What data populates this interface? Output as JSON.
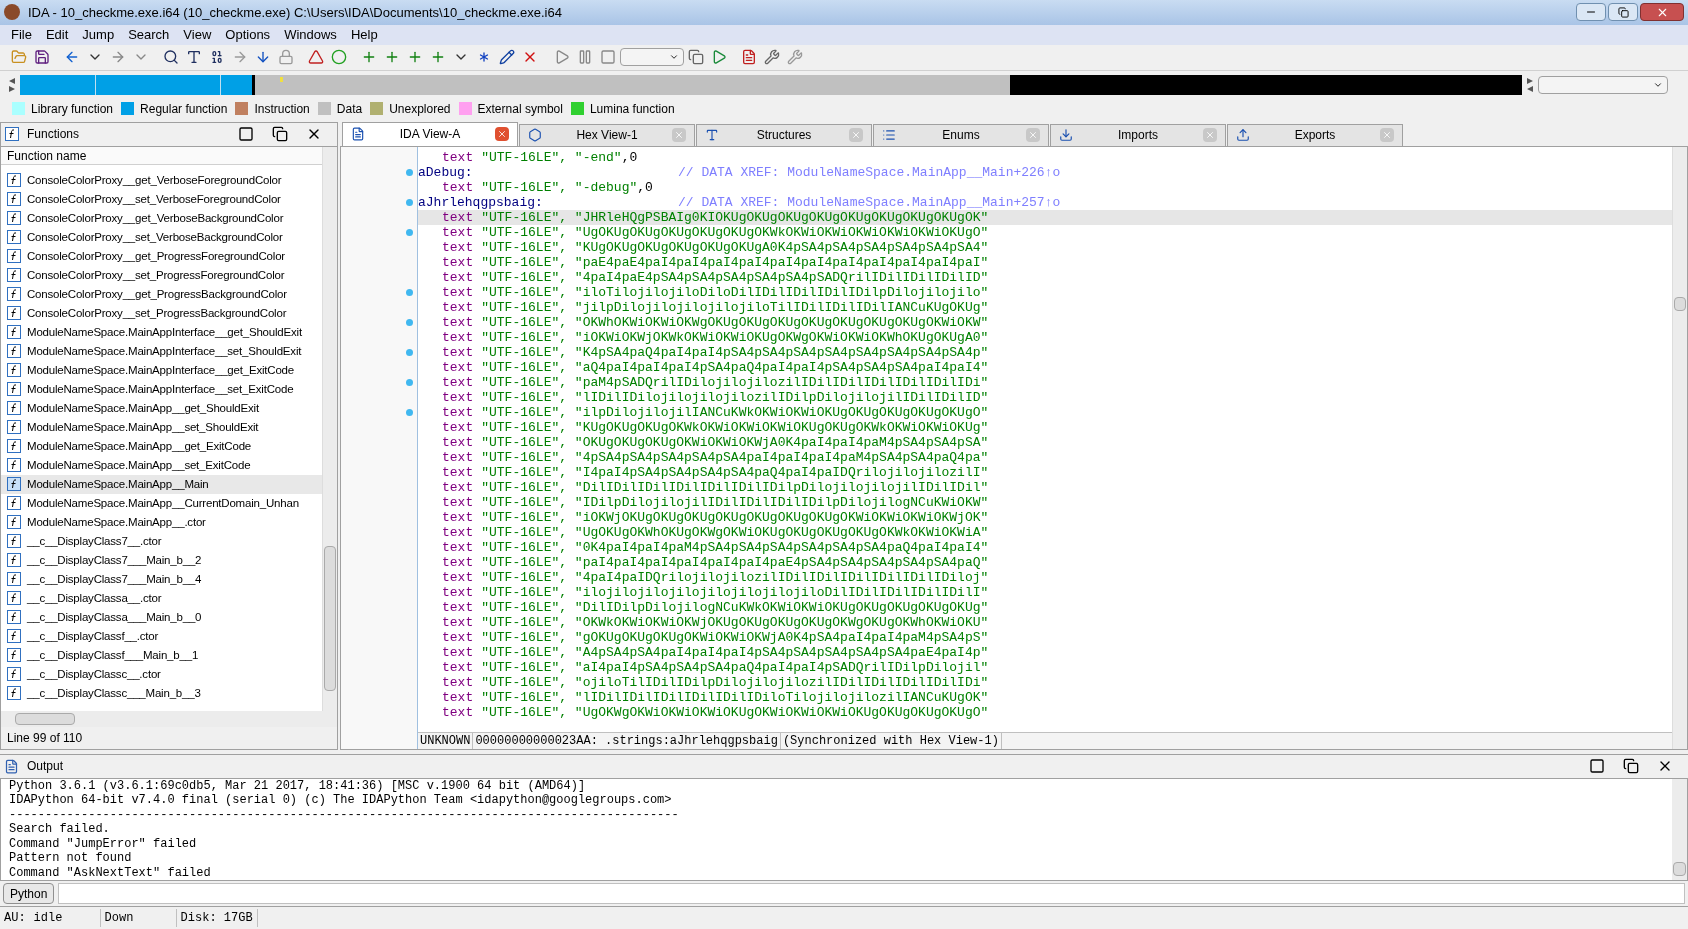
{
  "window": {
    "title": "IDA - 10_checkme.exe.i64 (10_checkme.exe) C:\\Users\\IDA\\Documents\\10_checkme.exe.i64"
  },
  "menu": [
    "File",
    "Edit",
    "Jump",
    "Search",
    "View",
    "Options",
    "Windows",
    "Help"
  ],
  "legend": [
    {
      "label": "Library function",
      "color": "#aaffff"
    },
    {
      "label": "Regular function",
      "color": "#00a0e6"
    },
    {
      "label": "Instruction",
      "color": "#c08060"
    },
    {
      "label": "Data",
      "color": "#c0c0c0"
    },
    {
      "label": "Unexplored",
      "color": "#b0b070"
    },
    {
      "label": "External symbol",
      "color": "#ffa0f0"
    },
    {
      "label": "Lumina function",
      "color": "#30d030"
    }
  ],
  "functions_panel": {
    "title": "Functions",
    "column": "Function name",
    "status": "Line 99 of 110",
    "items": [
      {
        "name": "ConsoleColorProxy__get_VerboseForegroundColor",
        "selected": false
      },
      {
        "name": "ConsoleColorProxy__set_VerboseForegroundColor",
        "selected": false
      },
      {
        "name": "ConsoleColorProxy__get_VerboseBackgroundColor",
        "selected": false
      },
      {
        "name": "ConsoleColorProxy__set_VerboseBackgroundColor",
        "selected": false
      },
      {
        "name": "ConsoleColorProxy__get_ProgressForegroundColor",
        "selected": false
      },
      {
        "name": "ConsoleColorProxy__set_ProgressForegroundColor",
        "selected": false
      },
      {
        "name": "ConsoleColorProxy__get_ProgressBackgroundColor",
        "selected": false
      },
      {
        "name": "ConsoleColorProxy__set_ProgressBackgroundColor",
        "selected": false
      },
      {
        "name": "ModuleNameSpace.MainAppInterface__get_ShouldExit",
        "selected": false
      },
      {
        "name": "ModuleNameSpace.MainAppInterface__set_ShouldExit",
        "selected": false
      },
      {
        "name": "ModuleNameSpace.MainAppInterface__get_ExitCode",
        "selected": false
      },
      {
        "name": "ModuleNameSpace.MainAppInterface__set_ExitCode",
        "selected": false
      },
      {
        "name": "ModuleNameSpace.MainApp__get_ShouldExit",
        "selected": false
      },
      {
        "name": "ModuleNameSpace.MainApp__set_ShouldExit",
        "selected": false
      },
      {
        "name": "ModuleNameSpace.MainApp__get_ExitCode",
        "selected": false
      },
      {
        "name": "ModuleNameSpace.MainApp__set_ExitCode",
        "selected": false
      },
      {
        "name": "ModuleNameSpace.MainApp__Main",
        "selected": true
      },
      {
        "name": "ModuleNameSpace.MainApp__CurrentDomain_Unhan",
        "selected": false
      },
      {
        "name": "ModuleNameSpace.MainApp__.ctor",
        "selected": false
      },
      {
        "name": "__c__DisplayClass7__.ctor",
        "selected": false
      },
      {
        "name": "__c__DisplayClass7___Main_b__2",
        "selected": false
      },
      {
        "name": "__c__DisplayClass7___Main_b__4",
        "selected": false
      },
      {
        "name": "__c__DisplayClassa__.ctor",
        "selected": false
      },
      {
        "name": "__c__DisplayClassa___Main_b__0",
        "selected": false
      },
      {
        "name": "__c__DisplayClassf__.ctor",
        "selected": false
      },
      {
        "name": "__c__DisplayClassf___Main_b__1",
        "selected": false
      },
      {
        "name": "__c__DisplayClassc__.ctor",
        "selected": false
      },
      {
        "name": "__c__DisplayClassc___Main_b__3",
        "selected": false
      }
    ]
  },
  "tabs": [
    {
      "label": "IDA View-A",
      "selected": true
    },
    {
      "label": "Hex View-1",
      "selected": false
    },
    {
      "label": "Structures",
      "selected": false
    },
    {
      "label": "Enums",
      "selected": false
    },
    {
      "label": "Imports",
      "selected": false
    },
    {
      "label": "Exports",
      "selected": false
    }
  ],
  "listing": [
    {
      "kind": "data",
      "keyword": "text",
      "operand": "\"UTF-16LE\", \"-end\"",
      "tail": ",0",
      "dot": false,
      "current": false
    },
    {
      "kind": "label",
      "name": "aDebug:",
      "comment": "// DATA XREF: ModuleNameSpace.MainApp__Main+226↑o",
      "dot": true,
      "current": false
    },
    {
      "kind": "data",
      "keyword": "text",
      "operand": "\"UTF-16LE\", \"-debug\"",
      "tail": ",0",
      "dot": false,
      "current": false
    },
    {
      "kind": "label",
      "name": "aJhrlehqgpsbaig:",
      "comment": "// DATA XREF: ModuleNameSpace.MainApp__Main+257↑o",
      "dot": true,
      "current": false
    },
    {
      "kind": "data",
      "keyword": "text",
      "operand": "\"UTF-16LE\", \"JHRleHQgPSBAIg0KIOKUgOKUgOKUgOKUgOKUgOKUgOKUgOKUgOK\"",
      "dot": false,
      "current": true
    },
    {
      "kind": "data",
      "keyword": "text",
      "operand": "\"UTF-16LE\", \"UgOKUgOKUgOKUgOKUgOKUgOKWkOKWiOKWiOKWiOKWiOKWiOKUgO\"",
      "dot": true,
      "current": false
    },
    {
      "kind": "data",
      "keyword": "text",
      "operand": "\"UTF-16LE\", \"KUgOKUgOKUgOKUgOKUgOKUgA0K4pSA4pSA4pSA4pSA4pSA4pSA4\"",
      "dot": false,
      "current": false
    },
    {
      "kind": "data",
      "keyword": "text",
      "operand": "\"UTF-16LE\", \"paE4paE4paI4paI4paI4paI4paI4paI4paI4paI4paI4paI4paI\"",
      "dot": false,
      "current": false
    },
    {
      "kind": "data",
      "keyword": "text",
      "operand": "\"UTF-16LE\", \"4paI4paE4pSA4pSA4pSA4pSA4pSA4pSADQrilIDilIDilIDilID\"",
      "dot": false,
      "current": false
    },
    {
      "kind": "data",
      "keyword": "text",
      "operand": "\"UTF-16LE\", \"iloTilojilojiloDiloDilIDilIDilIDilIDilpDilojilojilo\"",
      "dot": true,
      "current": false
    },
    {
      "kind": "data",
      "keyword": "text",
      "operand": "\"UTF-16LE\", \"jilpDilojilojilojilojiloTilIDilIDilIDilIANCuKUgOKUg\"",
      "dot": false,
      "current": false
    },
    {
      "kind": "data",
      "keyword": "text",
      "operand": "\"UTF-16LE\", \"OKWhOKWiOKWiOKWgOKUgOKUgOKUgOKUgOKUgOKUgOKUgOKWiOKW\"",
      "dot": true,
      "current": false
    },
    {
      "kind": "data",
      "keyword": "text",
      "operand": "\"UTF-16LE\", \"iOKWiOKWjOKWkOKWiOKWiOKUgOKWgOKWiOKWiOKWhOKUgOKUgA0\"",
      "dot": false,
      "current": false
    },
    {
      "kind": "data",
      "keyword": "text",
      "operand": "\"UTF-16LE\", \"K4pSA4paQ4paI4paI4pSA4pSA4pSA4pSA4pSA4pSA4pSA4pSA4p\"",
      "dot": true,
      "current": false
    },
    {
      "kind": "data",
      "keyword": "text",
      "operand": "\"UTF-16LE\", \"aQ4paI4paI4paI4pSA4paQ4paI4paI4pSA4pSA4pSA4paI4paI4\"",
      "dot": false,
      "current": false
    },
    {
      "kind": "data",
      "keyword": "text",
      "operand": "\"UTF-16LE\", \"paM4pSADQrilIDilojilojilozilIDilIDilIDilIDilIDilIDi\"",
      "dot": true,
      "current": false
    },
    {
      "kind": "data",
      "keyword": "text",
      "operand": "\"UTF-16LE\", \"lIDilIDilojilojilojilozilIDilpDilojilojilIDilIDilID\"",
      "dot": false,
      "current": false
    },
    {
      "kind": "data",
      "keyword": "text",
      "operand": "\"UTF-16LE\", \"ilpDilojilojilIANCuKWkOKWiOKWiOKUgOKUgOKUgOKUgOKUgO\"",
      "dot": true,
      "current": false
    },
    {
      "kind": "data",
      "keyword": "text",
      "operand": "\"UTF-16LE\", \"KUgOKUgOKUgOKWkOKWiOKWiOKWiOKUgOKUgOKWkOKWiOKWiOKUg\"",
      "dot": false,
      "current": false
    },
    {
      "kind": "data",
      "keyword": "text",
      "operand": "\"UTF-16LE\", \"OKUgOKUgOKUgOKWiOKWiOKWjA0K4paI4paI4paM4pSA4pSA4pSA\"",
      "dot": false,
      "current": false
    },
    {
      "kind": "data",
      "keyword": "text",
      "operand": "\"UTF-16LE\", \"4pSA4pSA4pSA4pSA4pSA4paI4paI4paI4paM4pSA4pSA4paQ4pa\"",
      "dot": false,
      "current": false
    },
    {
      "kind": "data",
      "keyword": "text",
      "operand": "\"UTF-16LE\", \"I4paI4pSA4pSA4pSA4pSA4paQ4paI4paIDQrilojilojilozilI\"",
      "dot": false,
      "current": false
    },
    {
      "kind": "data",
      "keyword": "text",
      "operand": "\"UTF-16LE\", \"DilIDilIDilIDilIDilIDilIDilpDilojilojilojilIDilIDil\"",
      "dot": false,
      "current": false
    },
    {
      "kind": "data",
      "keyword": "text",
      "operand": "\"UTF-16LE\", \"IDilpDilojilojilIDilIDilIDilIDilpDilojilogNCuKWiOKW\"",
      "dot": false,
      "current": false
    },
    {
      "kind": "data",
      "keyword": "text",
      "operand": "\"UTF-16LE\", \"iOKWjOKUgOKUgOKUgOKUgOKUgOKUgOKUgOKWiOKWiOKWiOKWjOK\"",
      "dot": false,
      "current": false
    },
    {
      "kind": "data",
      "keyword": "text",
      "operand": "\"UTF-16LE\", \"UgOKUgOKWhOKUgOKWgOKWiOKUgOKUgOKUgOKUgOKWkOKWiOKWiA\"",
      "dot": false,
      "current": false
    },
    {
      "kind": "data",
      "keyword": "text",
      "operand": "\"UTF-16LE\", \"0K4paI4paI4paM4pSA4pSA4pSA4pSA4pSA4pSA4paQ4paI4paI4\"",
      "dot": false,
      "current": false
    },
    {
      "kind": "data",
      "keyword": "text",
      "operand": "\"UTF-16LE\", \"paI4paI4paI4paI4paI4paI4paE4pSA4pSA4pSA4pSA4pSA4paQ\"",
      "dot": false,
      "current": false
    },
    {
      "kind": "data",
      "keyword": "text",
      "operand": "\"UTF-16LE\", \"4paI4paIDQrilojilojilozilIDilIDilIDilIDilIDilIDiloj\"",
      "dot": false,
      "current": false
    },
    {
      "kind": "data",
      "keyword": "text",
      "operand": "\"UTF-16LE\", \"ilojilojilojilojilojilojilojiloDilIDilIDilIDilIDilI\"",
      "dot": false,
      "current": false
    },
    {
      "kind": "data",
      "keyword": "text",
      "operand": "\"UTF-16LE\", \"DilIDilpDilojilogNCuKWkOKWiOKWiOKUgOKUgOKUgOKUgOKUg\"",
      "dot": false,
      "current": false
    },
    {
      "kind": "data",
      "keyword": "text",
      "operand": "\"UTF-16LE\", \"OKWkOKWiOKWiOKWjOKUgOKUgOKUgOKUgOKWgOKUgOKWhOKWiOKU\"",
      "dot": false,
      "current": false
    },
    {
      "kind": "data",
      "keyword": "text",
      "operand": "\"UTF-16LE\", \"gOKUgOKUgOKUgOKWiOKWiOKWjA0K4pSA4paI4paI4paM4pSA4pS\"",
      "dot": false,
      "current": false
    },
    {
      "kind": "data",
      "keyword": "text",
      "operand": "\"UTF-16LE\", \"A4pSA4pSA4paI4paI4paI4pSA4pSA4pSA4pSA4pSA4paE4paI4p\"",
      "dot": false,
      "current": false
    },
    {
      "kind": "data",
      "keyword": "text",
      "operand": "\"UTF-16LE\", \"aI4paI4pSA4pSA4pSA4paQ4paI4paI4pSADQrilIDilpDilojil\"",
      "dot": false,
      "current": false
    },
    {
      "kind": "data",
      "keyword": "text",
      "operand": "\"UTF-16LE\", \"ojiloTilIDilIDilpDilojilojilozilIDilIDilIDilIDilIDi\"",
      "dot": false,
      "current": false
    },
    {
      "kind": "data",
      "keyword": "text",
      "operand": "\"UTF-16LE\", \"lIDilIDilIDilIDilIDilIDiloTilojilojilozilIANCuKUgOK\"",
      "dot": false,
      "current": false
    },
    {
      "kind": "data",
      "keyword": "text",
      "operand": "\"UTF-16LE\", \"UgOKWgOKWiOKWiOKWiOKUgOKWiOKWiOKWiOKUgOKUgOKUgOKUgO\"",
      "dot": false,
      "current": false
    }
  ],
  "listing_status": [
    "UNKNOWN",
    "00000000000023AA: .strings:aJhrlehqgpsbaig",
    "(Synchronized with Hex View-1)"
  ],
  "output": {
    "title": "Output",
    "lines": [
      "Python 3.6.1 (v3.6.1:69c0db5, Mar 21 2017, 18:41:36) [MSC v.1900 64 bit (AMD64)]",
      "IDAPython 64-bit v7.4.0 final (serial 0) (c) The IDAPython Team <idapython@googlegroups.com>",
      "---------------------------------------------------------------------------------------------",
      "Search failed.",
      "Command \"JumpError\" failed",
      "Pattern not found",
      "Command \"AskNextText\" failed"
    ],
    "interpreter": "Python"
  },
  "status_bar": [
    "AU:",
    "idle",
    "Down",
    "Disk: 17GB"
  ]
}
